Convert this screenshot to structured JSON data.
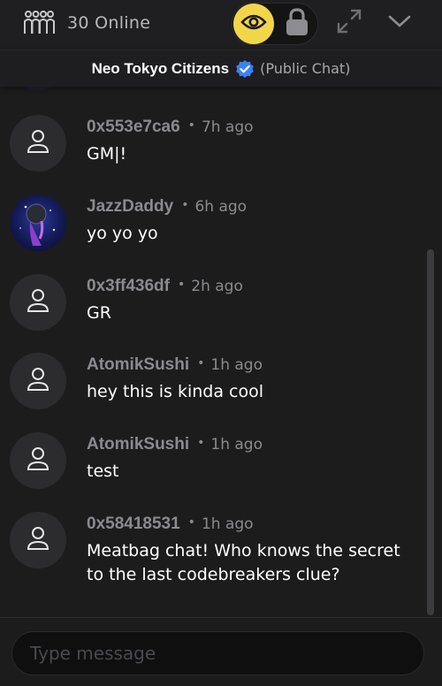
{
  "header": {
    "online_label": "30 Online",
    "icons": {
      "online": "people-group-icon",
      "visibility": "eye-icon",
      "lock": "lock-icon",
      "expand": "expand-icon",
      "collapse": "chevron-down-icon"
    },
    "accent_color": "#f2d64a"
  },
  "chat": {
    "room_name": "Neo Tokyo Citizens",
    "verified_icon": "verified-badge-icon",
    "verified_color": "#3b82f6",
    "room_type": "(Public Chat)"
  },
  "messages": [
    {
      "user": "0x553e7ca6",
      "time": "7h ago",
      "text": "GM|!",
      "avatar": "user-icon"
    },
    {
      "user": "JazzDaddy",
      "time": "6h ago",
      "text": "yo yo yo",
      "avatar": "profile-image"
    },
    {
      "user": "0x3ff436df",
      "time": "2h ago",
      "text": "GR",
      "avatar": "user-icon"
    },
    {
      "user": "AtomikSushi",
      "time": "1h ago",
      "text": "hey this is kinda cool",
      "avatar": "user-icon"
    },
    {
      "user": "AtomikSushi",
      "time": "1h ago",
      "text": "test",
      "avatar": "user-icon"
    },
    {
      "user": "0x58418531",
      "time": "1h ago",
      "text": "Meatbag chat! Who knows the secret to the last codebreakers clue?",
      "avatar": "user-icon"
    }
  ],
  "composer": {
    "placeholder": "Type message",
    "value": ""
  }
}
